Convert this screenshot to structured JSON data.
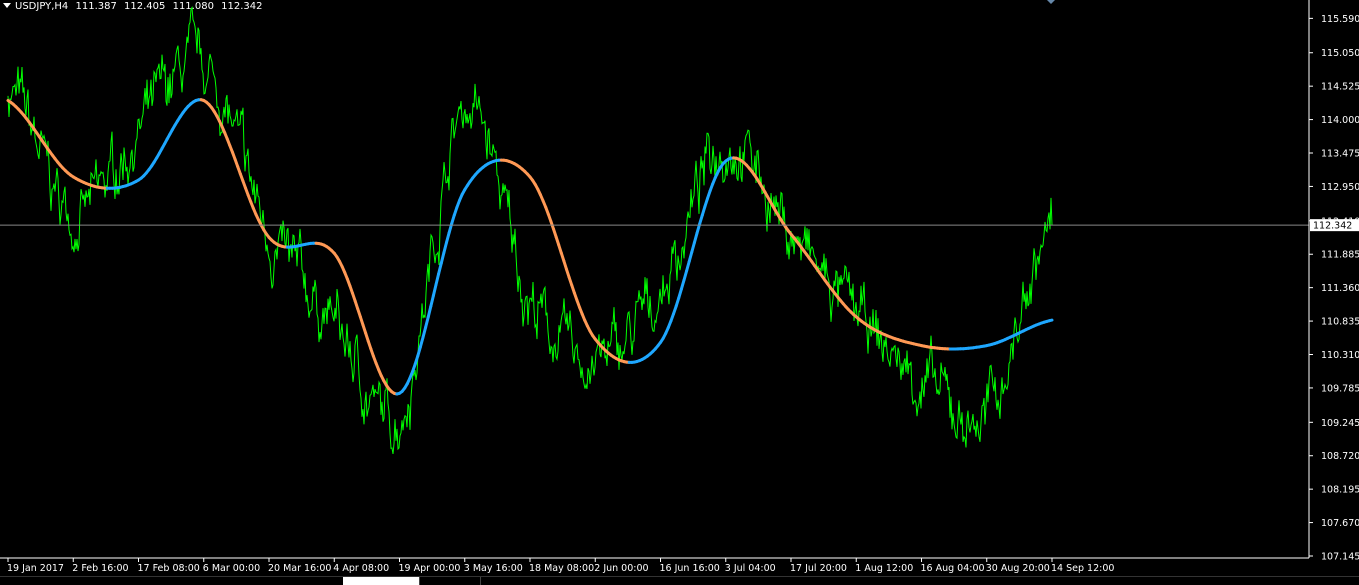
{
  "header": {
    "symbol": "USDJPY,H4",
    "ohlc": [
      "111.387",
      "112.405",
      "111.080",
      "112.342"
    ]
  },
  "price_label": "112.342",
  "colors": {
    "background": "#000000",
    "price": "#00ff00",
    "ma_up": "#1ea7ff",
    "ma_down": "#ff9955",
    "grid_line": "#888888"
  },
  "chart_data": {
    "type": "line",
    "title": "",
    "xlabel": "",
    "ylabel": "",
    "ylim": [
      107.145,
      115.69
    ],
    "y_ticks": [
      "115.590",
      "115.050",
      "114.525",
      "114.000",
      "113.475",
      "112.950",
      "112.410",
      "111.885",
      "111.360",
      "110.835",
      "110.310",
      "109.785",
      "109.245",
      "108.720",
      "108.195",
      "107.670",
      "107.145"
    ],
    "x_ticks": [
      "19 Jan 2017",
      "2 Feb 16:00",
      "17 Feb 08:00",
      "6 Mar 00:00",
      "20 Mar 16:00",
      "4 Apr 08:00",
      "19 Apr 00:00",
      "3 May 16:00",
      "18 May 08:00",
      "2 Jun 00:00",
      "16 Jun 16:00",
      "3 Jul 04:00",
      "17 Jul 20:00",
      "1 Aug 12:00",
      "16 Aug 04:00",
      "30 Aug 20:00",
      "14 Sep 12:00"
    ],
    "current_price": 112.342,
    "grid": false,
    "series": [
      {
        "style": "close",
        "x": [
          "19 Jan 2017",
          "2 Feb 16:00",
          "17 Feb 08:00",
          "6 Mar 00:00",
          "20 Mar 16:00",
          "4 Apr 08:00",
          "19 Apr 00:00",
          "3 May 16:00",
          "18 May 08:00",
          "2 Jun 00:00",
          "16 Jun 16:00",
          "3 Jul 04:00",
          "17 Jul 20:00",
          "1 Aug 12:00",
          "16 Aug 04:00",
          "30 Aug 20:00",
          "14 Sep 12:00"
        ],
        "values": [
          114.5,
          112.5,
          113.8,
          114.8,
          112.2,
          110.8,
          109.4,
          114.2,
          111.2,
          110.2,
          111.3,
          113.7,
          112.2,
          110.9,
          109.9,
          109.4,
          112.34
        ]
      },
      {
        "style": "moving-average",
        "x": [
          "19 Jan 2017",
          "2 Feb 16:00",
          "17 Feb 08:00",
          "6 Mar 00:00",
          "20 Mar 16:00",
          "4 Apr 08:00",
          "19 Apr 00:00",
          "3 May 16:00",
          "18 May 08:00",
          "2 Jun 00:00",
          "16 Jun 16:00",
          "3 Jul 04:00",
          "17 Jul 20:00",
          "1 Aug 12:00",
          "16 Aug 04:00",
          "30 Aug 20:00",
          "14 Sep 12:00"
        ],
        "values": [
          114.3,
          113.1,
          113.05,
          114.3,
          112.15,
          111.9,
          109.7,
          112.9,
          113.1,
          110.55,
          110.5,
          113.35,
          112.2,
          110.9,
          110.45,
          110.45,
          110.85
        ]
      }
    ]
  }
}
